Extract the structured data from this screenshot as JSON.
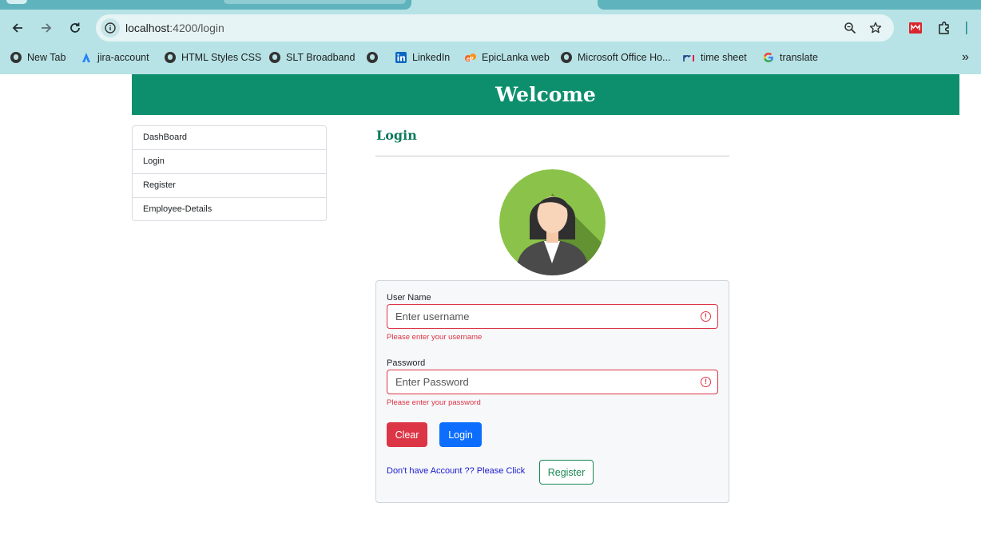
{
  "browser": {
    "url_host": "localhost",
    "url_path": ":4200/login",
    "bookmarks": [
      {
        "label": "New Tab",
        "icon": "globe-icon"
      },
      {
        "label": "jira-account",
        "icon": "jira-icon"
      },
      {
        "label": "HTML Styles CSS",
        "icon": "globe-icon"
      },
      {
        "label": "SLT Broadband",
        "icon": "globe-icon"
      },
      {
        "label": "",
        "icon": "globe-icon"
      },
      {
        "label": "LinkedIn",
        "icon": "linkedin-icon"
      },
      {
        "label": "EpicLanka web",
        "icon": "epiclanka-icon"
      },
      {
        "label": "Microsoft Office Ho...",
        "icon": "globe-icon"
      },
      {
        "label": "time sheet",
        "icon": "timesheet-icon"
      },
      {
        "label": "translate",
        "icon": "google-icon"
      }
    ],
    "overflow_label": "»"
  },
  "header": {
    "title": "Welcome"
  },
  "sidebar": {
    "items": [
      {
        "label": "DashBoard"
      },
      {
        "label": "Login"
      },
      {
        "label": "Register"
      },
      {
        "label": "Employee-Details"
      }
    ]
  },
  "login": {
    "title": "Login",
    "username": {
      "label": "User Name",
      "placeholder": "Enter username",
      "value": "",
      "error": "Please enter your username"
    },
    "password": {
      "label": "Password",
      "placeholder": "Enter Password",
      "value": "",
      "error": "Please enter your password"
    },
    "clear_label": "Clear",
    "login_label": "Login",
    "register_prompt": "Don't have Account ?? Please Click",
    "register_label": "Register"
  },
  "colors": {
    "banner": "#0d8f6d",
    "error": "#dc3545",
    "primary": "#0d6efd",
    "success": "#198754"
  }
}
